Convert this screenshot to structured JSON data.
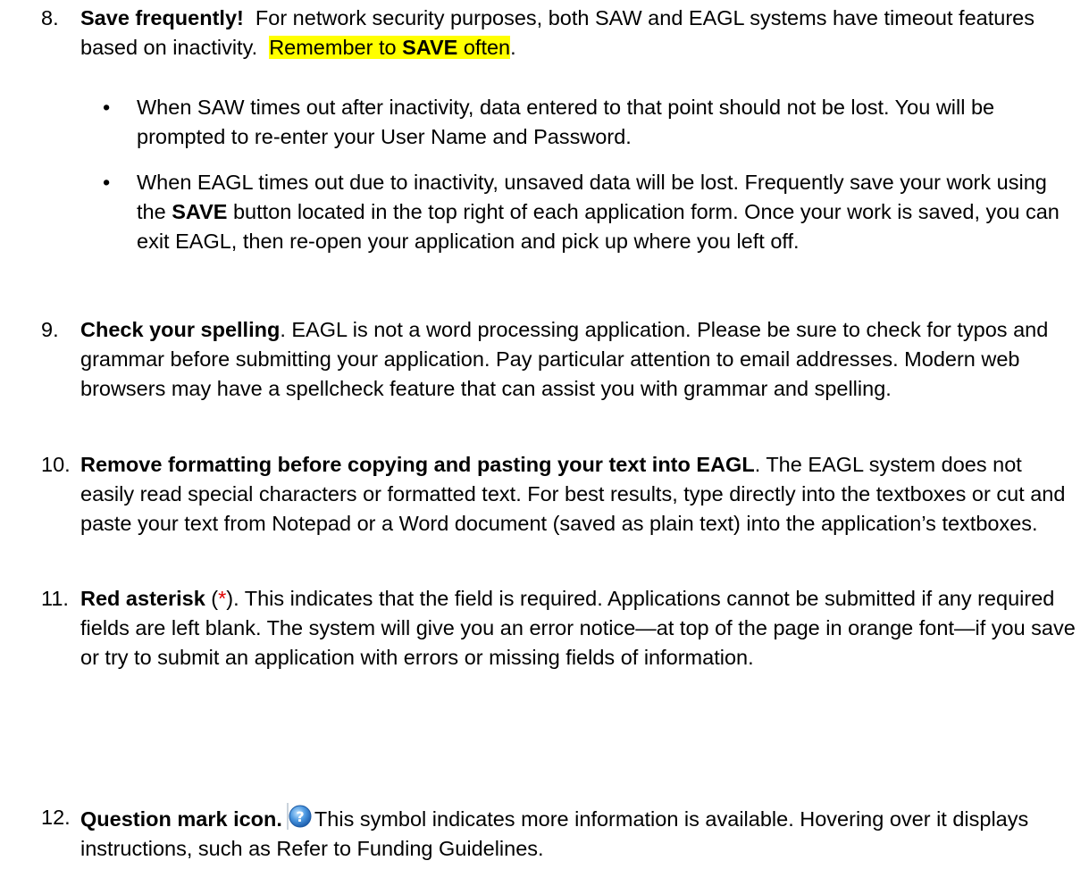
{
  "items": [
    {
      "number": "8.",
      "title": "Save frequently!",
      "text": "For network security purposes, both SAW and EAGL systems have timeout features based on inactivity.",
      "highlight_pre": "Remember to",
      "highlight_bold": "SAVE",
      "highlight_post": "often",
      "end": ".",
      "bullets": [
        {
          "text": "When SAW times out after inactivity, data entered to that point should not be lost. You will be prompted to re-enter your User Name and Password."
        },
        {
          "pre": "When EAGL times out due to inactivity, unsaved data will be lost.  Frequently save your work using the",
          "bold": "SAVE",
          "post": "button located in the top right of each application form.  Once your work is saved, you can exit EAGL, then re-open your application and pick up where you left off."
        }
      ]
    },
    {
      "number": "9.",
      "title": "Check your spelling",
      "text": ".  EAGL is not a word processing application. Please be sure to check for typos and grammar before submitting your application.  Pay particular attention to email addresses.  Modern web browsers may have a spellcheck feature that can assist you with grammar and spelling."
    },
    {
      "number": "10.",
      "title": "Remove formatting before copying and pasting your text into EAGL",
      "text": ".  The EAGL system does not easily read special characters or formatted text.  For best results, type directly into the textboxes or cut and paste your text from Notepad or a Word document (saved as plain text) into the application’s textboxes."
    },
    {
      "number": "11.",
      "title": "Red asterisk",
      "open_paren": " (",
      "asterisk": "*",
      "text": ").  This indicates that the field is required.  Applications cannot be submitted if any required fields are left blank.  The system will give you an error notice—at top of the page in orange font—if you save or try to submit an application with errors or missing fields of information."
    },
    {
      "number": "12.",
      "title": "Question mark icon.",
      "icon": "question-mark-help-icon",
      "text": "This symbol indicates more information is available.  Hovering over it displays instructions, such as Refer to Funding Guidelines."
    }
  ],
  "colors": {
    "highlight": "#ffff00",
    "asterisk": "#e00000",
    "icon_blue": "#3a86d6"
  }
}
